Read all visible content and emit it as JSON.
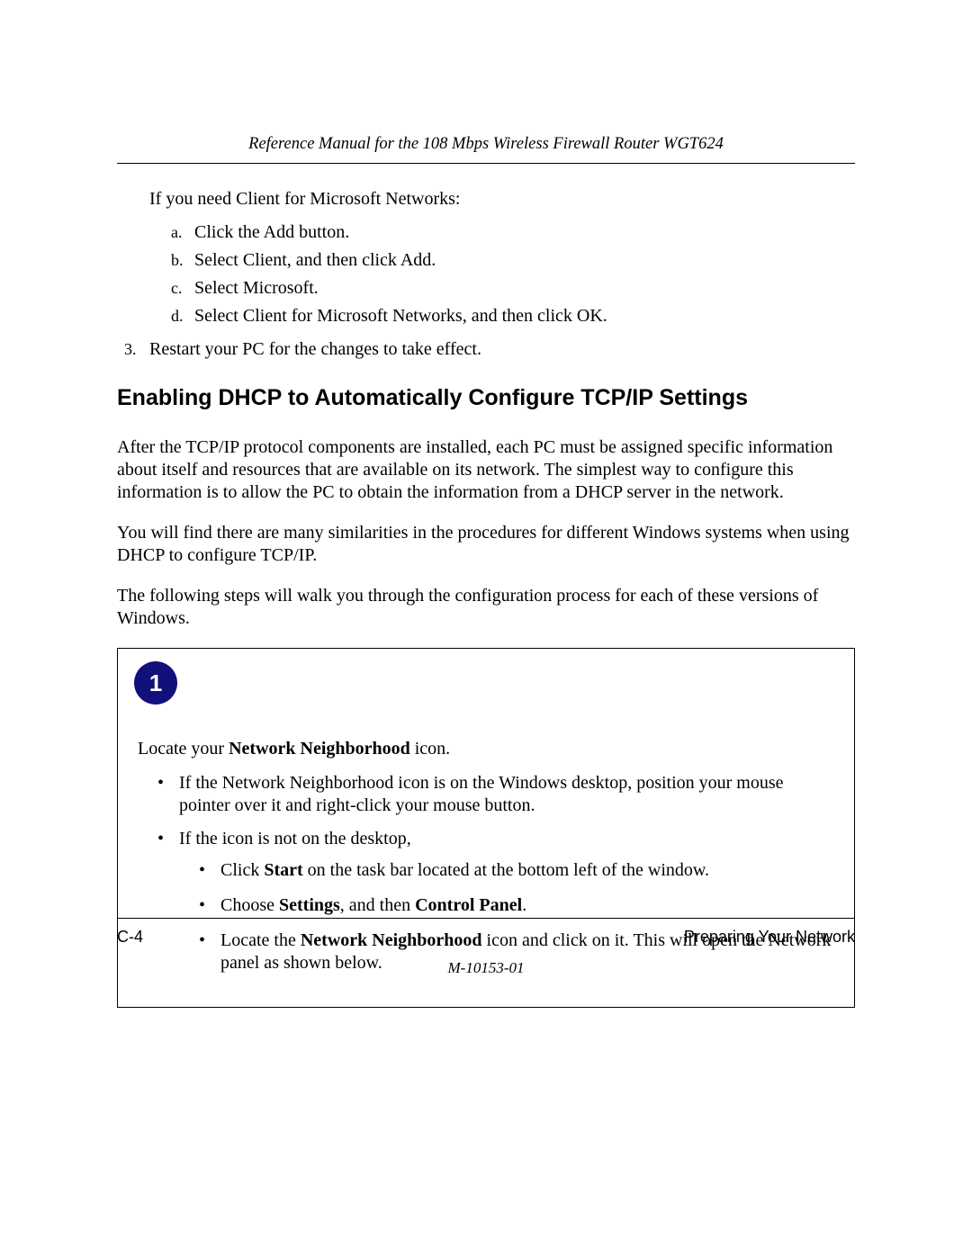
{
  "header": {
    "title": "Reference Manual for the 108 Mbps Wireless Firewall Router WGT624"
  },
  "intro": {
    "lead": "If you need Client for Microsoft Networks:",
    "sub_items": {
      "a": {
        "marker": "a.",
        "text": "Click the Add button."
      },
      "b": {
        "marker": "b.",
        "text": "Select Client, and then click Add."
      },
      "c": {
        "marker": "c.",
        "text": "Select Microsoft."
      },
      "d": {
        "marker": "d.",
        "text": "Select Client for Microsoft Networks, and then click OK."
      }
    },
    "num3": {
      "marker": "3.",
      "text": "Restart your PC for the changes to take effect."
    }
  },
  "section": {
    "heading": "Enabling DHCP to Automatically Configure TCP/IP Settings",
    "p1": "After the TCP/IP protocol components are installed, each PC must be assigned specific information about itself and resources that are available on its network. The simplest way to configure this information is to allow the PC to obtain the information from a DHCP server in the network.",
    "p2": "You will find there are many similarities in the procedures for different Windows systems when using DHCP to configure TCP/IP.",
    "p3": "The following steps will walk you through the configuration process for each of these versions of Windows."
  },
  "step": {
    "badge": "1",
    "lead_pre": "Locate your ",
    "lead_bold": "Network Neighborhood",
    "lead_post": " icon.",
    "b1": "If the Network Neighborhood icon is on the Windows desktop, position your mouse pointer over it and right-click your mouse button.",
    "b2": "If the icon is not on the desktop,",
    "s1_pre": "Click ",
    "s1_b": "Start",
    "s1_post": " on the task bar located at the bottom left of the window.",
    "s2_pre": "Choose ",
    "s2_b1": "Settings",
    "s2_mid": ", and then ",
    "s2_b2": "Control Panel",
    "s2_post": ".",
    "s3_pre": "Locate the ",
    "s3_b": "Network Neighborhood",
    "s3_post": " icon and click on it. This will open the Network panel as shown below."
  },
  "footer": {
    "page_no": "C-4",
    "section_name": "Preparing Your Network",
    "doc_code": "M-10153-01"
  }
}
